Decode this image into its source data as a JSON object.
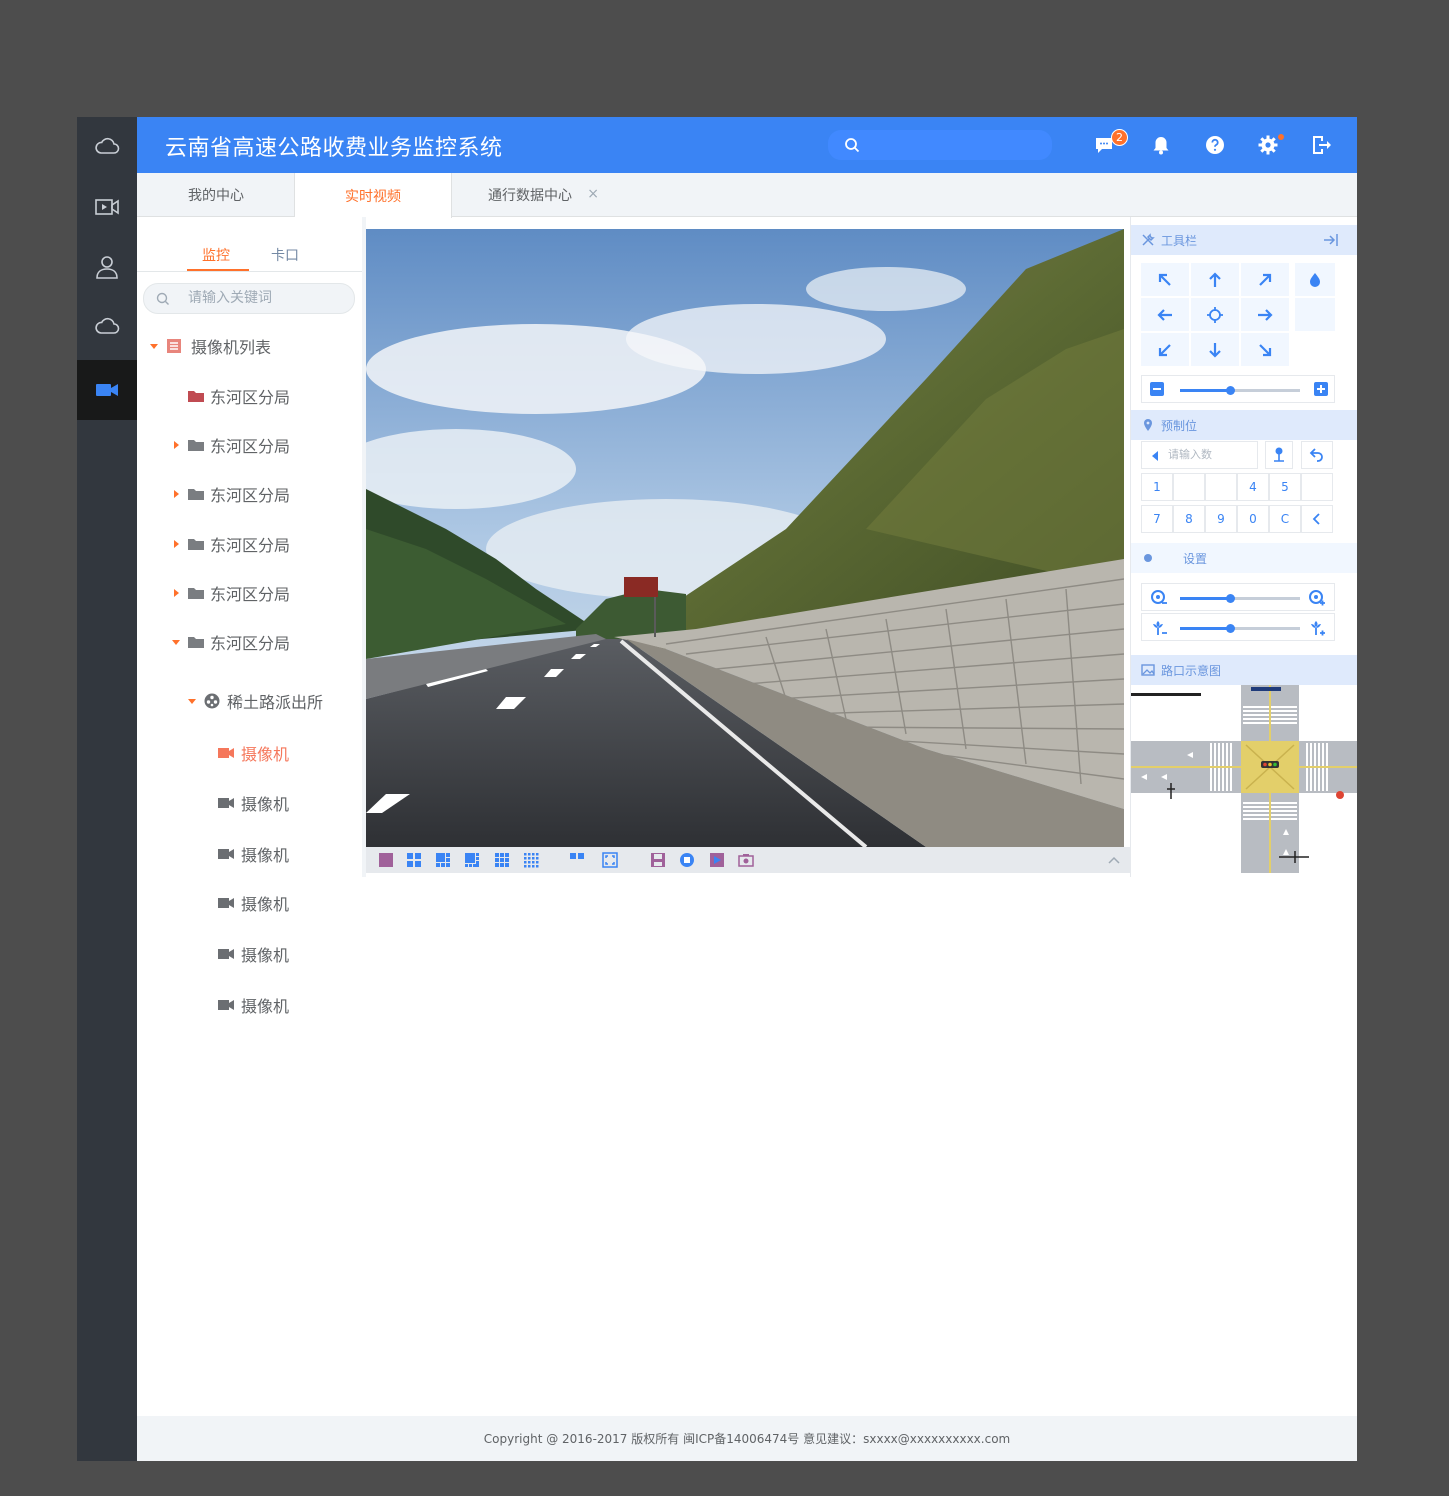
{
  "colors": {
    "header_bg": "#3a84f4",
    "search_bg": "#4189FF",
    "rail_bg": "#32373E",
    "rail_active": "#181919",
    "accent_orange": "#FF712B",
    "camera_active": "#F5775B",
    "tree_text": "#606366",
    "subtab_text": "#7489A4",
    "placeholder": "#9FAAB5",
    "tab_bar_bg": "#F1F4F7",
    "panel_head": "#DFEAFC",
    "panel_head_text": "#6A96DE",
    "ptz_btn_bg": "#F1F7FF",
    "toolbar_bg": "#E6E9ED",
    "toolbar_icon": "#C6CED9"
  },
  "header": {
    "title": "云南省高速公路收费业务监控系统",
    "search_placeholder": "",
    "message_badge": "2",
    "icons": [
      "message-icon",
      "bell-icon",
      "help-icon",
      "gear-icon",
      "logout-icon"
    ]
  },
  "rail": {
    "items": [
      "cloud-icon",
      "video-icon",
      "user-icon",
      "cloud-icon",
      "camera-icon"
    ],
    "active_index": 4
  },
  "tabs": [
    {
      "label": "我的中心"
    },
    {
      "label": "实时视频"
    },
    {
      "label": "通行数据中心",
      "close": "×"
    }
  ],
  "active_tab": 1,
  "left_panel": {
    "subtabs": [
      {
        "label": "监控"
      },
      {
        "label": "卡口"
      }
    ],
    "active_subtab": 0,
    "search_placeholder": "请输入关键词",
    "tree": {
      "root": "摄像机列表",
      "branches": [
        "东河区分局",
        "东河区分局",
        "东河区分局",
        "东河区分局",
        "东河区分局",
        "东河区分局"
      ],
      "station": "稀土路派出所",
      "cameras": [
        "摄像机",
        "摄像机",
        "摄像机",
        "摄像机",
        "摄像机",
        "摄像机"
      ]
    }
  },
  "video_toolbar": {
    "buttons": [
      "layout-1-icon",
      "layout-4-icon",
      "layout-6-icon",
      "layout-8-icon",
      "layout-9-icon",
      "layout-16-icon",
      "layout-custom-icon",
      "fullscreen-icon",
      "save-icon",
      "record-icon",
      "play-icon",
      "snapshot-icon"
    ]
  },
  "right_panel": {
    "toolbar_title": "工具栏",
    "preset_title": "预制位",
    "preset_placeholder": "请输入数",
    "image_settings_title": "设置",
    "junction_title": "路口示意图",
    "numpad": [
      "1",
      "",
      "",
      "4",
      "5",
      "",
      "7",
      "8",
      "9",
      "0",
      "C",
      ""
    ],
    "zoom_level": 0.42,
    "focus_level": 0.42,
    "iris_level": 0.42
  },
  "footer": {
    "text": "Copyright @ 2016-2017  版权所有 闽ICP备14006474号 意见建议：sxxxx@xxxxxxxxxx.com"
  }
}
